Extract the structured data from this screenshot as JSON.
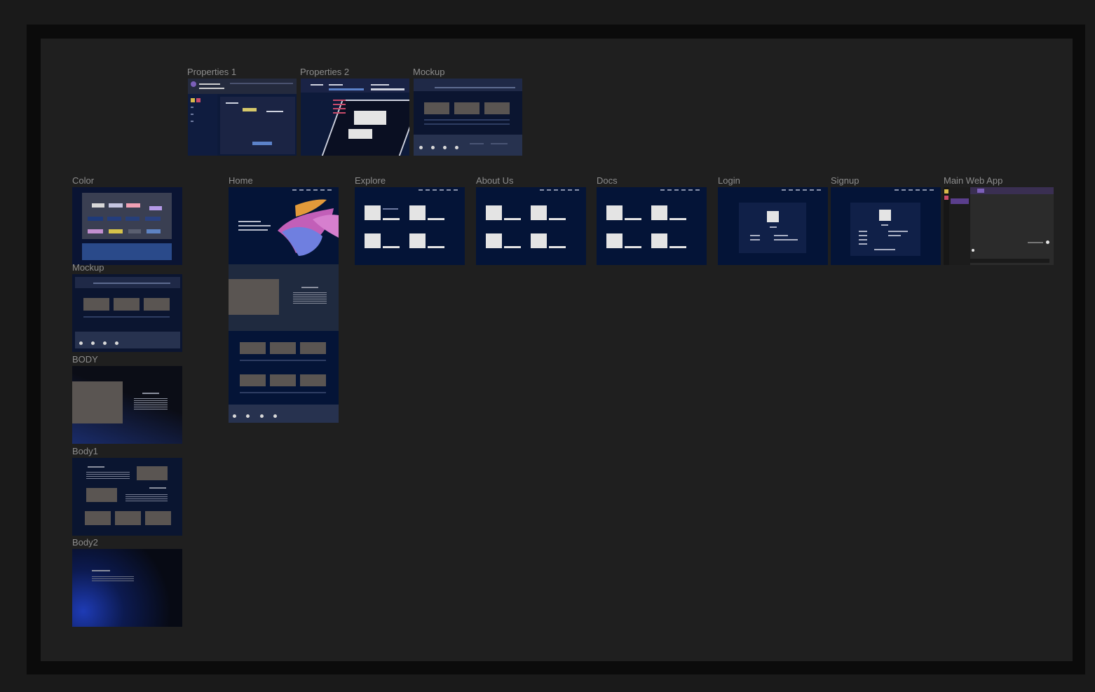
{
  "canvas": {
    "frames": {
      "properties_1": "Properties 1",
      "properties_2": "Properties 2",
      "mockup_top": "Mockup",
      "color": "Color",
      "mockup_left": "Mockup",
      "body": "BODY",
      "body1": "Body1",
      "body2": "Body2",
      "home": "Home",
      "explore": "Explore",
      "about_us": "About Us",
      "docs": "Docs",
      "login": "Login",
      "signup": "Signup",
      "main_web_app": "Main Web App"
    }
  },
  "colors": {
    "canvas_bg": "#1f1f1f",
    "frame_navy": "#041437",
    "card_white": "#e4e4e4",
    "accent_purple": "#7b5fb8"
  }
}
